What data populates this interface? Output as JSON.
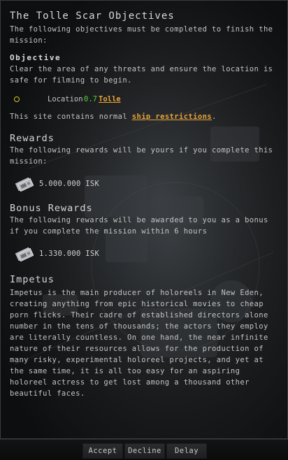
{
  "window": {
    "title": "The Tolle Scar Objectives",
    "intro": "The following objectives must be completed to finish the mission:"
  },
  "objective": {
    "heading": "Objective",
    "text": "Clear the area of any threats and ensure the location is safe for filming to begin.",
    "location_label": "Location",
    "security": "0.7",
    "system": "Tolle",
    "restrictions_prefix": "This site contains normal ",
    "restrictions_link": "ship restrictions",
    "restrictions_suffix": "."
  },
  "rewards": {
    "heading": "Rewards",
    "text": "The following rewards will be yours if you complete this mission:",
    "amount": "5.000.000 ISK"
  },
  "bonus": {
    "heading": "Bonus Rewards",
    "text": "The following rewards will be awarded to you as a bonus if you complete the mission within 6 hours",
    "amount": "1.330.000 ISK"
  },
  "agent_corp": {
    "heading": "Impetus",
    "text": "Impetus is the main producer of holoreels in New Eden, creating anything from epic historical movies to cheap porn flicks. Their cadre of established directors alone number in the tens of thousands; the actors they employ are literally countless. On one hand, the near infinite nature of their resources allows for the production of many risky, experimental holoreel projects, and yet at the same time, it is all too easy for an aspiring holoreel actress to get lost among a thousand other beautiful faces."
  },
  "buttons": {
    "accept": "Accept",
    "decline": "Decline",
    "delay": "Delay"
  },
  "colors": {
    "link": "#e8a23a",
    "security": "#4fd33a",
    "location_icon": "#d6c72a"
  },
  "icons": {
    "location": "location-circle-icon",
    "isk": "isk-banknote-icon"
  }
}
